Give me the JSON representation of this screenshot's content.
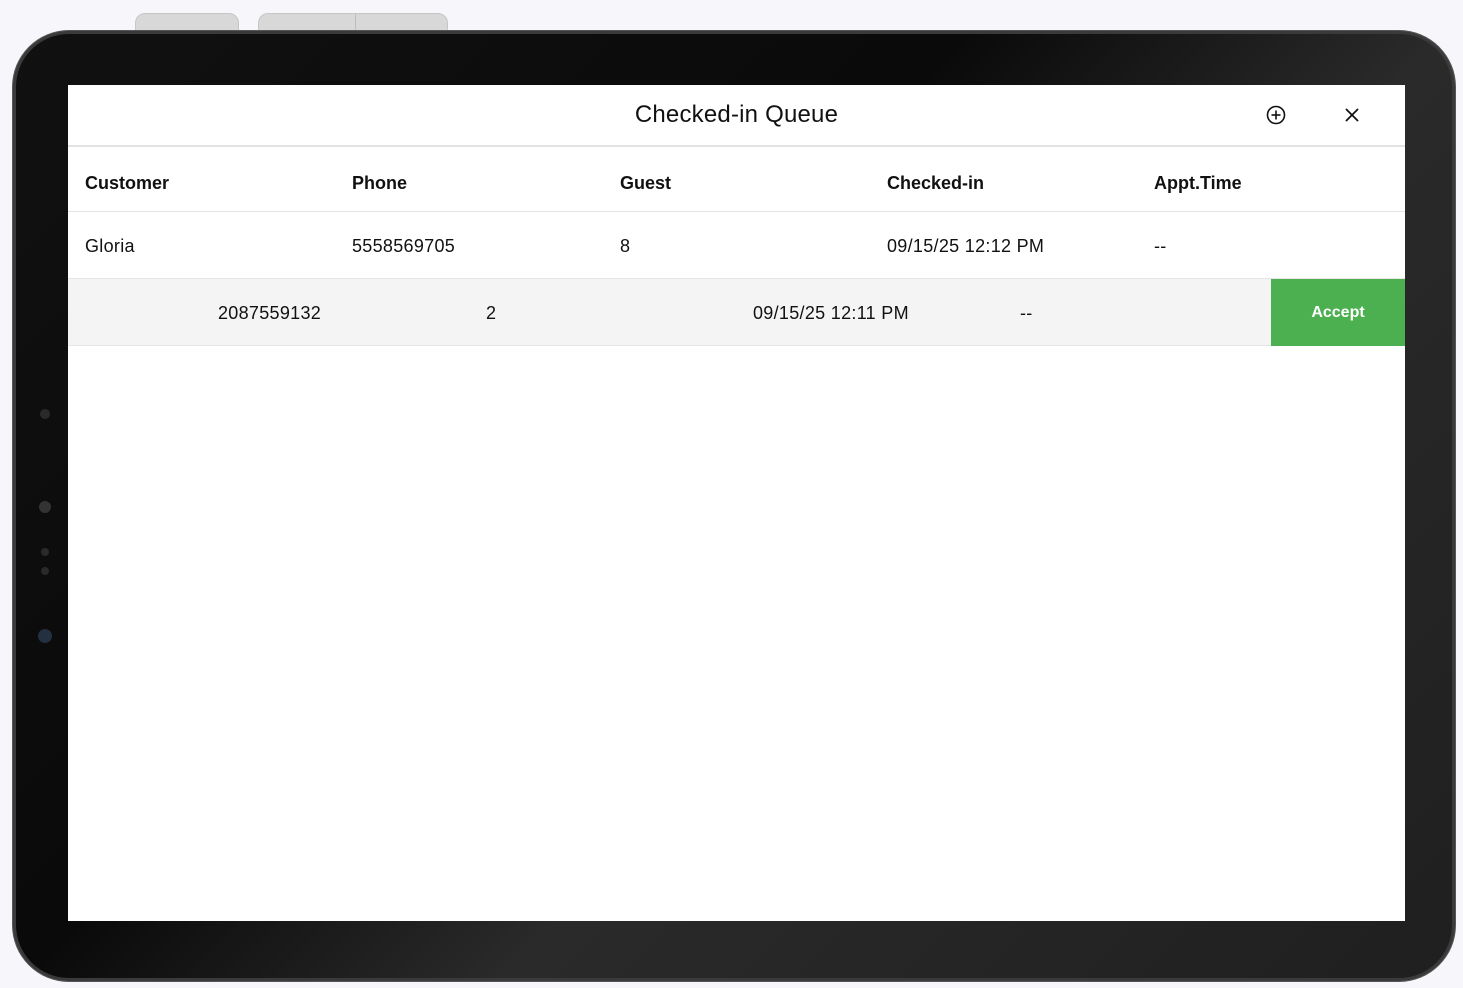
{
  "queue": {
    "title": "Checked-in Queue",
    "add_icon": "add-circle-icon",
    "close_icon": "close-icon"
  },
  "columns": [
    "Customer",
    "Phone",
    "Guest",
    "Checked-in",
    "Appt.Time"
  ],
  "rows": [
    {
      "customer": "Gloria",
      "phone": "5558569705",
      "guest": "8",
      "checked_in": "09/15/25 12:12 PM",
      "appt_time": "--"
    },
    {
      "customer": "",
      "phone": "2087559132",
      "guest": "2",
      "checked_in": "09/15/25 12:11 PM",
      "appt_time": "--",
      "action_label": "Accept"
    }
  ],
  "colors": {
    "accent": "#4caf50",
    "alt_row": "#f4f4f4"
  }
}
